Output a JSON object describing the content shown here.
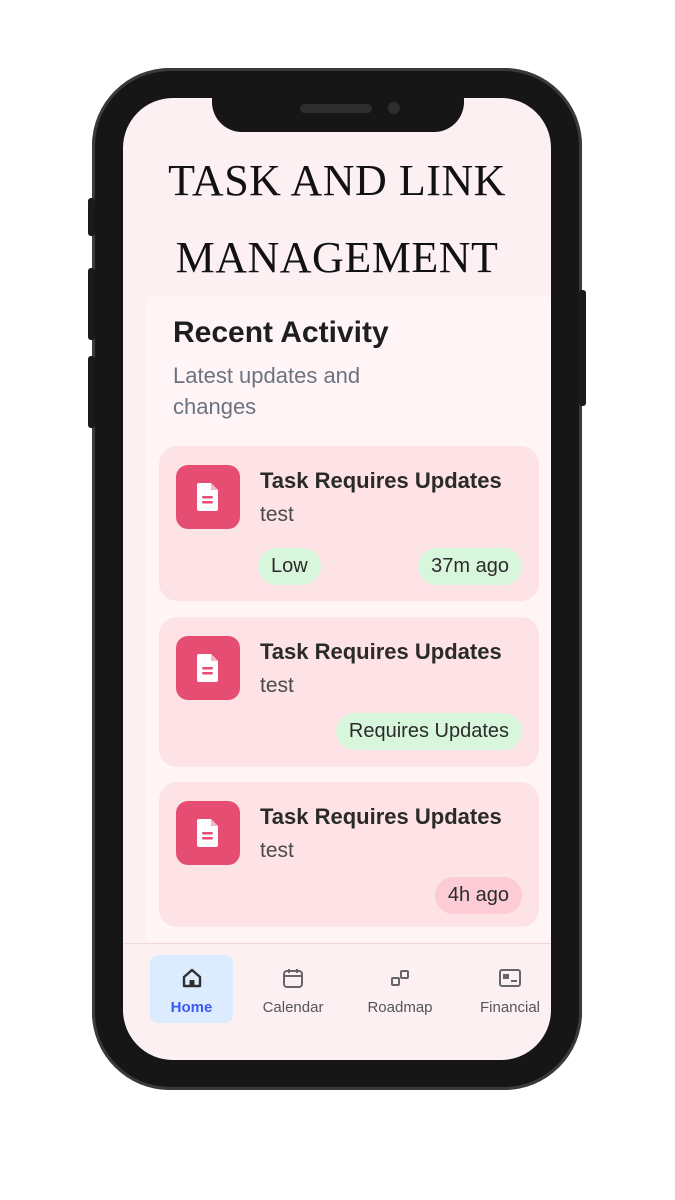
{
  "app": {
    "title_line1": "TASK AND LINK",
    "title_line2": "MANAGEMENT"
  },
  "recent_activity": {
    "title": "Recent Activity",
    "subtitle": "Latest updates and changes",
    "items": [
      {
        "title": "Task Requires Updates",
        "description": "test",
        "priority": "Low",
        "time": "37m ago",
        "icon": "document-icon"
      },
      {
        "title": "Task Requires Updates",
        "description": "test",
        "status": "Requires Updates",
        "icon": "document-icon"
      },
      {
        "title": "Task Requires Updates",
        "description": "test",
        "time": "4h ago",
        "icon": "document-icon"
      }
    ]
  },
  "tabs": [
    {
      "label": "Home",
      "icon": "home-icon",
      "active": true
    },
    {
      "label": "Calendar",
      "icon": "calendar-icon",
      "active": false
    },
    {
      "label": "Roadmap",
      "icon": "roadmap-icon",
      "active": false
    },
    {
      "label": "Financial",
      "icon": "financial-icon",
      "active": false
    }
  ],
  "colors": {
    "accent": "#e64d73",
    "active_tab": "#3b5bf0",
    "green_pill": "#d8f6dc",
    "pink_pill": "#fbccd5"
  }
}
